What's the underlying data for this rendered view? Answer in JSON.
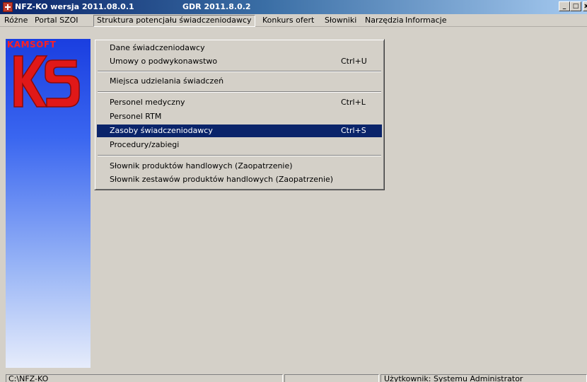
{
  "titlebar": {
    "title": "NFZ-KO wersja 2011.08.0.1",
    "gdr": "GDR 2011.8.0.2",
    "min_glyph": "_",
    "max_glyph": "□",
    "close_glyph": "x"
  },
  "menubar": {
    "items": [
      {
        "label": "Różne"
      },
      {
        "label": "Portal SZOI"
      },
      {
        "label": "Struktura potencjału świadczeniodawcy"
      },
      {
        "label": "Konkurs ofert"
      },
      {
        "label": "Słowniki"
      },
      {
        "label": "Narzędzia"
      },
      {
        "label": "Informacje"
      }
    ]
  },
  "brand": {
    "name": "KAMSOFT",
    "colors": {
      "brand_red": "#ff2020",
      "panel_blue": "#1a3ee0",
      "highlight": "#0a246a"
    }
  },
  "dropdown": {
    "items": [
      {
        "label": "Dane świadczeniodawcy",
        "shortcut": ""
      },
      {
        "label": "Umowy o podwykonawstwo",
        "shortcut": "Ctrl+U"
      },
      {
        "label": "Miejsca udzielania świadczeń",
        "shortcut": ""
      },
      {
        "label": "Personel medyczny",
        "shortcut": "Ctrl+L"
      },
      {
        "label": "Personel RTM",
        "shortcut": ""
      },
      {
        "label": "Zasoby świadczeniodawcy",
        "shortcut": "Ctrl+S"
      },
      {
        "label": "Procedury/zabiegi",
        "shortcut": ""
      },
      {
        "label": "Słownik produktów handlowych (Zaopatrzenie)",
        "shortcut": ""
      },
      {
        "label": "Słownik zestawów produktów handlowych (Zaopatrzenie)",
        "shortcut": ""
      }
    ]
  },
  "statusbar": {
    "path": "C:\\NFZ-KO",
    "middle": "",
    "user_label": "Użytkownik:",
    "user_name": "Systemu Administrator"
  }
}
